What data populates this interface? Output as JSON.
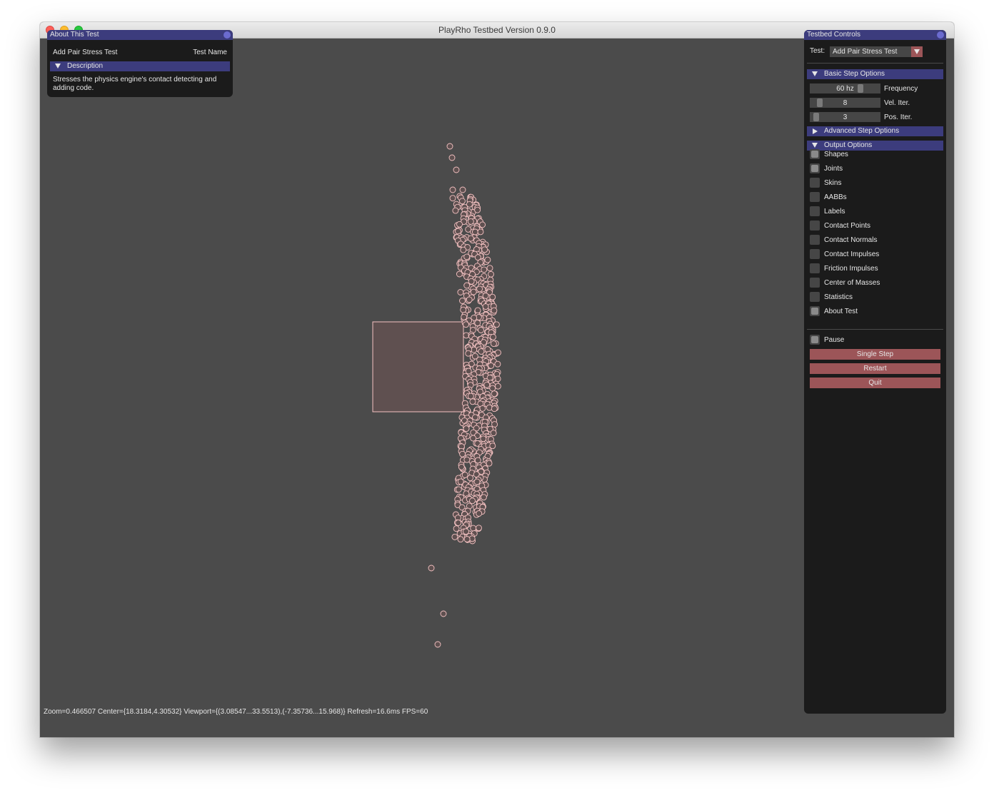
{
  "window": {
    "title": "PlayRho Testbed Version 0.9.0"
  },
  "about_panel": {
    "title": "About This Test",
    "test_name_value": "Add Pair Stress Test",
    "test_name_label": "Test Name",
    "description_header": "Description",
    "description_text": "Stresses the physics engine's contact detecting and adding code."
  },
  "controls": {
    "title": "Testbed Controls",
    "test_label": "Test:",
    "test_selected": "Add Pair Stress Test",
    "basic_step_header": "Basic Step Options",
    "frequency": {
      "value": "60 hz",
      "label": "Frequency"
    },
    "vel_iter": {
      "value": "8",
      "label": "Vel. Iter."
    },
    "pos_iter": {
      "value": "3",
      "label": "Pos. Iter."
    },
    "advanced_step_header": "Advanced Step Options",
    "output_header": "Output Options",
    "output_options": [
      {
        "label": "Shapes",
        "checked": true
      },
      {
        "label": "Joints",
        "checked": true
      },
      {
        "label": "Skins",
        "checked": false
      },
      {
        "label": "AABBs",
        "checked": false
      },
      {
        "label": "Labels",
        "checked": false
      },
      {
        "label": "Contact Points",
        "checked": false
      },
      {
        "label": "Contact Normals",
        "checked": false
      },
      {
        "label": "Contact Impulses",
        "checked": false
      },
      {
        "label": "Friction Impulses",
        "checked": false
      },
      {
        "label": "Center of Masses",
        "checked": false
      },
      {
        "label": "Statistics",
        "checked": false
      },
      {
        "label": "About Test",
        "checked": true
      }
    ],
    "pause": {
      "label": "Pause",
      "checked": true
    },
    "single_step_label": "Single Step",
    "restart_label": "Restart",
    "quit_label": "Quit"
  },
  "status_bar": {
    "text": "Zoom=0.466507 Center={18.3184,4.30532} Viewport={(3.08547...33.5513),(-7.35736...15.968)} Refresh=16.6ms FPS=60"
  },
  "colors": {
    "viewport_bg": "#4b4b4b",
    "panel_bg": "#1b1b1b",
    "header_blue": "#3c3c7d",
    "button_red": "#9c5558",
    "body_outline": "#f4c2c2",
    "box_fill": "#5f5050"
  }
}
